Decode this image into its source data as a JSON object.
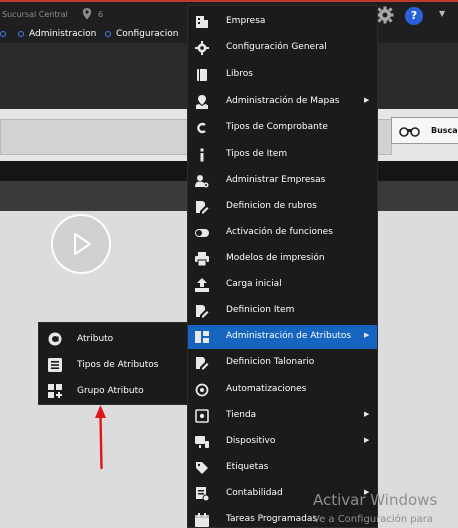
{
  "header": {
    "branch": "Sucursal Central",
    "count": "6",
    "help_label": "?",
    "icons": [
      "map-pin-icon",
      "gear-icon",
      "help-icon",
      "chevron-down-icon"
    ]
  },
  "nav": {
    "items": [
      {
        "label": "Administracion"
      },
      {
        "label": "Configuracion"
      }
    ]
  },
  "toolbar": {
    "search_label": "Buscar"
  },
  "main_menu": {
    "items": [
      {
        "label": "Empresa",
        "icon": "building-icon"
      },
      {
        "label": "Configuración General",
        "icon": "gear-icon"
      },
      {
        "label": "Libros",
        "icon": "book-icon"
      },
      {
        "label": "Administración de Mapas",
        "icon": "map-icon",
        "submenu": true
      },
      {
        "label": "Tipos de Comprobante",
        "icon": "letter-c-icon"
      },
      {
        "label": "Tipos de Item",
        "icon": "info-icon"
      },
      {
        "label": "Administrar Empresas",
        "icon": "user-gear-icon"
      },
      {
        "label": "Definicion de rubros",
        "icon": "edit-icon"
      },
      {
        "label": "Activación de funciones",
        "icon": "toggle-icon"
      },
      {
        "label": "Modelos de impresión",
        "icon": "printer-icon"
      },
      {
        "label": "Carga inicial",
        "icon": "upload-icon"
      },
      {
        "label": "Definicion Item",
        "icon": "edit-icon"
      },
      {
        "label": "Administración de Atributos",
        "icon": "attributes-icon",
        "submenu": true,
        "active": true
      },
      {
        "label": "Definicion Talonario",
        "icon": "edit-icon"
      },
      {
        "label": "Automatizaciones",
        "icon": "cog-icon"
      },
      {
        "label": "Tienda",
        "icon": "store-icon",
        "submenu": true
      },
      {
        "label": "Dispositivo",
        "icon": "device-icon",
        "submenu": true
      },
      {
        "label": "Etiquetas",
        "icon": "tag-icon"
      },
      {
        "label": "Contabilidad",
        "icon": "ledger-icon",
        "submenu": true
      },
      {
        "label": "Tareas Programadas",
        "icon": "calendar-icon"
      }
    ]
  },
  "sub_menu": {
    "items": [
      {
        "label": "Atributo",
        "icon": "a-circle-icon"
      },
      {
        "label": "Tipos de Atributos",
        "icon": "list-icon"
      },
      {
        "label": "Grupo Atributo",
        "icon": "grid-plus-icon"
      }
    ]
  },
  "watermark": {
    "title": "Activar Windows",
    "subtitle": "Ve a Configuración para"
  },
  "colors": {
    "accent": "#1565c0",
    "topbar": "#1f1f1f",
    "menu_bg": "#1b1b1b",
    "arrow": "#e3141b"
  }
}
